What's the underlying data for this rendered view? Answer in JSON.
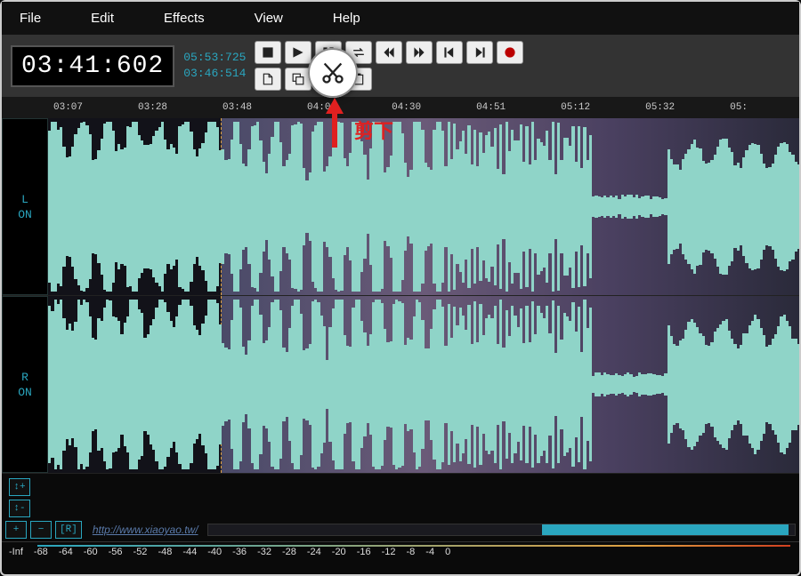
{
  "menu": {
    "file": "File",
    "edit": "Edit",
    "effects": "Effects",
    "view": "View",
    "help": "Help"
  },
  "time": {
    "main": "03:41:602",
    "sel_start": "05:53:725",
    "sel_end": "03:46:514"
  },
  "ruler": [
    "03:07",
    "03:28",
    "03:48",
    "04:09",
    "04:30",
    "04:51",
    "05:12",
    "05:32",
    "05:"
  ],
  "track_left": {
    "name": "L",
    "state": "ON"
  },
  "track_right": {
    "name": "R",
    "state": "ON"
  },
  "zoom": {
    "plus": "+",
    "minus": "−",
    "r": "[R]",
    "vplus": "↕+",
    "vminus": "↕-"
  },
  "watermark_url": "http://www.xiaoyao.tw/",
  "db_scale": [
    "-Inf",
    "-68",
    "-64",
    "-60",
    "-56",
    "-52",
    "-48",
    "-44",
    "-40",
    "-36",
    "-32",
    "-28",
    "-24",
    "-20",
    "-16",
    "-12",
    "-8",
    "-4",
    "0"
  ],
  "annotation": {
    "label": "剪下"
  }
}
